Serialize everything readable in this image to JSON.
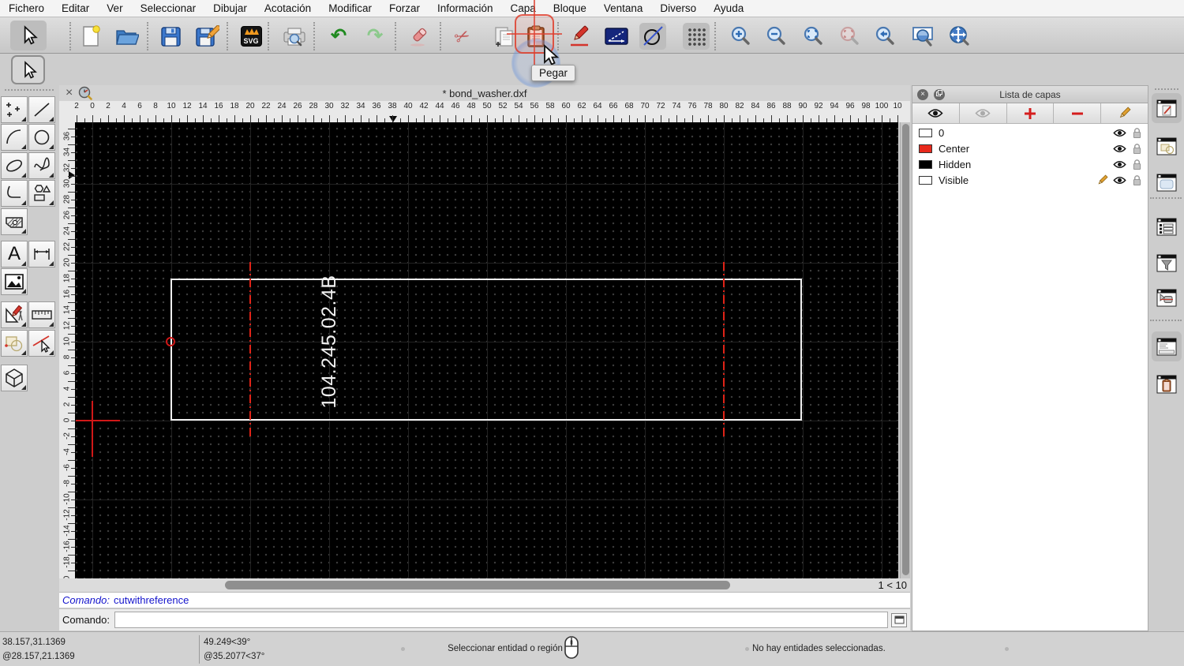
{
  "menu": {
    "items": [
      "Fichero",
      "Editar",
      "Ver",
      "Seleccionar",
      "Dibujar",
      "Acotación",
      "Modificar",
      "Forzar",
      "Información",
      "Capa",
      "Bloque",
      "Ventana",
      "Diverso",
      "Ayuda"
    ]
  },
  "icons": {
    "close": "×",
    "undo": "↶",
    "redo": "↷",
    "cut": "✂",
    "panel_close": "×"
  },
  "toolbar": {
    "paste_tooltip": "Pegar",
    "svg_badge_label": "SVG"
  },
  "tools": {
    "text_glyph": "A"
  },
  "tab": {
    "title": "* bond_washer.dxf"
  },
  "rulers": {
    "h_labels": [
      "2",
      "0",
      "2",
      "4",
      "6",
      "8",
      "10",
      "12",
      "14",
      "16",
      "18",
      "20",
      "22",
      "24",
      "26",
      "28",
      "30",
      "32",
      "34",
      "36",
      "38",
      "40",
      "42",
      "44",
      "46",
      "48",
      "50",
      "52",
      "54",
      "56",
      "58",
      "60",
      "62",
      "64",
      "66",
      "68",
      "70",
      "72",
      "74",
      "76",
      "78",
      "80",
      "82",
      "84",
      "86",
      "88",
      "90",
      "92",
      "94",
      "96",
      "98",
      "100",
      "10"
    ],
    "v_labels": [
      "36",
      "34",
      "32",
      "30",
      "28",
      "26",
      "24",
      "22",
      "20",
      "18",
      "16",
      "14",
      "12",
      "10",
      "8",
      "6",
      "4",
      "2",
      "0",
      "-2",
      "-4",
      "-6",
      "-8",
      "-10",
      "-12",
      "-14",
      "-16",
      "-18",
      "0"
    ]
  },
  "canvas": {
    "part_label": "104.245.02.4B",
    "outline_color": "#f0f0f0",
    "centerline_color": "#e02317",
    "background": "#000000"
  },
  "scroll": {
    "zoom_indicator": "1 < 10"
  },
  "command": {
    "history_label": "Comando:",
    "history_value": "cutwithreference",
    "prompt_label": "Comando:",
    "input_value": ""
  },
  "layers_panel": {
    "title": "Lista de capas",
    "layers": [
      {
        "name": "0",
        "color": "#ffffff",
        "current": false
      },
      {
        "name": "Center",
        "color": "#e8291c",
        "current": false
      },
      {
        "name": "Hidden",
        "color": "#000000",
        "current": false
      },
      {
        "name": "Visible",
        "color": "#ffffff",
        "current": true
      }
    ]
  },
  "statusbar": {
    "abs_coord": "38.157,31.1369",
    "rel_coord": "@28.157,21.1369",
    "abs_polar": "49.249<39°",
    "rel_polar": "@35.2077<37°",
    "hint": "Seleccionar entidad o región",
    "selection_status": "No hay entidades seleccionadas."
  }
}
